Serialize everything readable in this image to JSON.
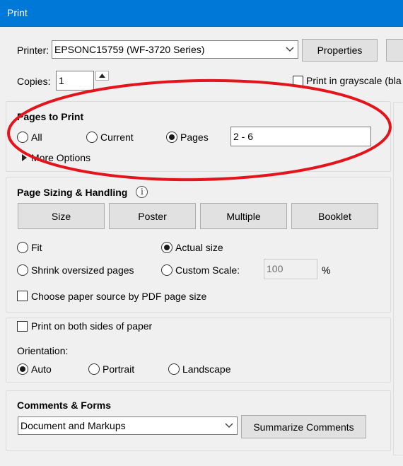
{
  "window": {
    "title": "Print"
  },
  "printer": {
    "label": "Printer:",
    "selected": "EPSONC15759 (WF-3720 Series)",
    "properties_label": "Properties"
  },
  "copies": {
    "label": "Copies:",
    "value": "1",
    "grayscale_label": "Print in grayscale (bla"
  },
  "pages_to_print": {
    "heading": "Pages to Print",
    "options": [
      "All",
      "Current",
      "Pages"
    ],
    "selected": "Pages",
    "range_value": "2 - 6",
    "more_options_label": "More Options"
  },
  "sizing": {
    "heading": "Page Sizing & Handling",
    "info_icon": "info-icon",
    "tabs": [
      "Size",
      "Poster",
      "Multiple",
      "Booklet"
    ],
    "fit_label": "Fit",
    "actual_size_label": "Actual size",
    "shrink_label": "Shrink oversized pages",
    "custom_scale_label": "Custom Scale:",
    "custom_scale_value": "100",
    "percent_label": "%",
    "choose_source_label": "Choose paper source by PDF page size",
    "selected": "Actual size"
  },
  "duplex": {
    "both_sides_label": "Print on both sides of paper",
    "orientation_label": "Orientation:",
    "options": [
      "Auto",
      "Portrait",
      "Landscape"
    ],
    "selected": "Auto"
  },
  "comments": {
    "heading": "Comments & Forms",
    "selected": "Document and Markups",
    "summarize_label": "Summarize Comments"
  },
  "colors": {
    "titlebar": "#0078d7",
    "annotation": "#e3141b"
  }
}
